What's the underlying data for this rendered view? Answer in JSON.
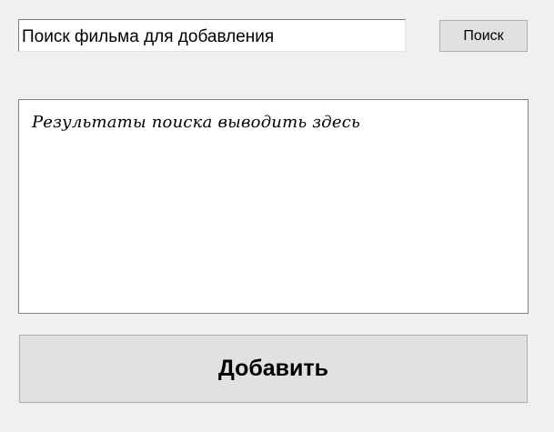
{
  "search": {
    "value": "Поиск фильма для добавления",
    "button_label": "Поиск"
  },
  "results": {
    "placeholder_text": "Результаты поиска выводить здесь"
  },
  "actions": {
    "add_label": "Добавить"
  },
  "colors": {
    "window_background": "#f0f0f0",
    "button_background": "#e1e1e1",
    "field_background": "#ffffff"
  }
}
